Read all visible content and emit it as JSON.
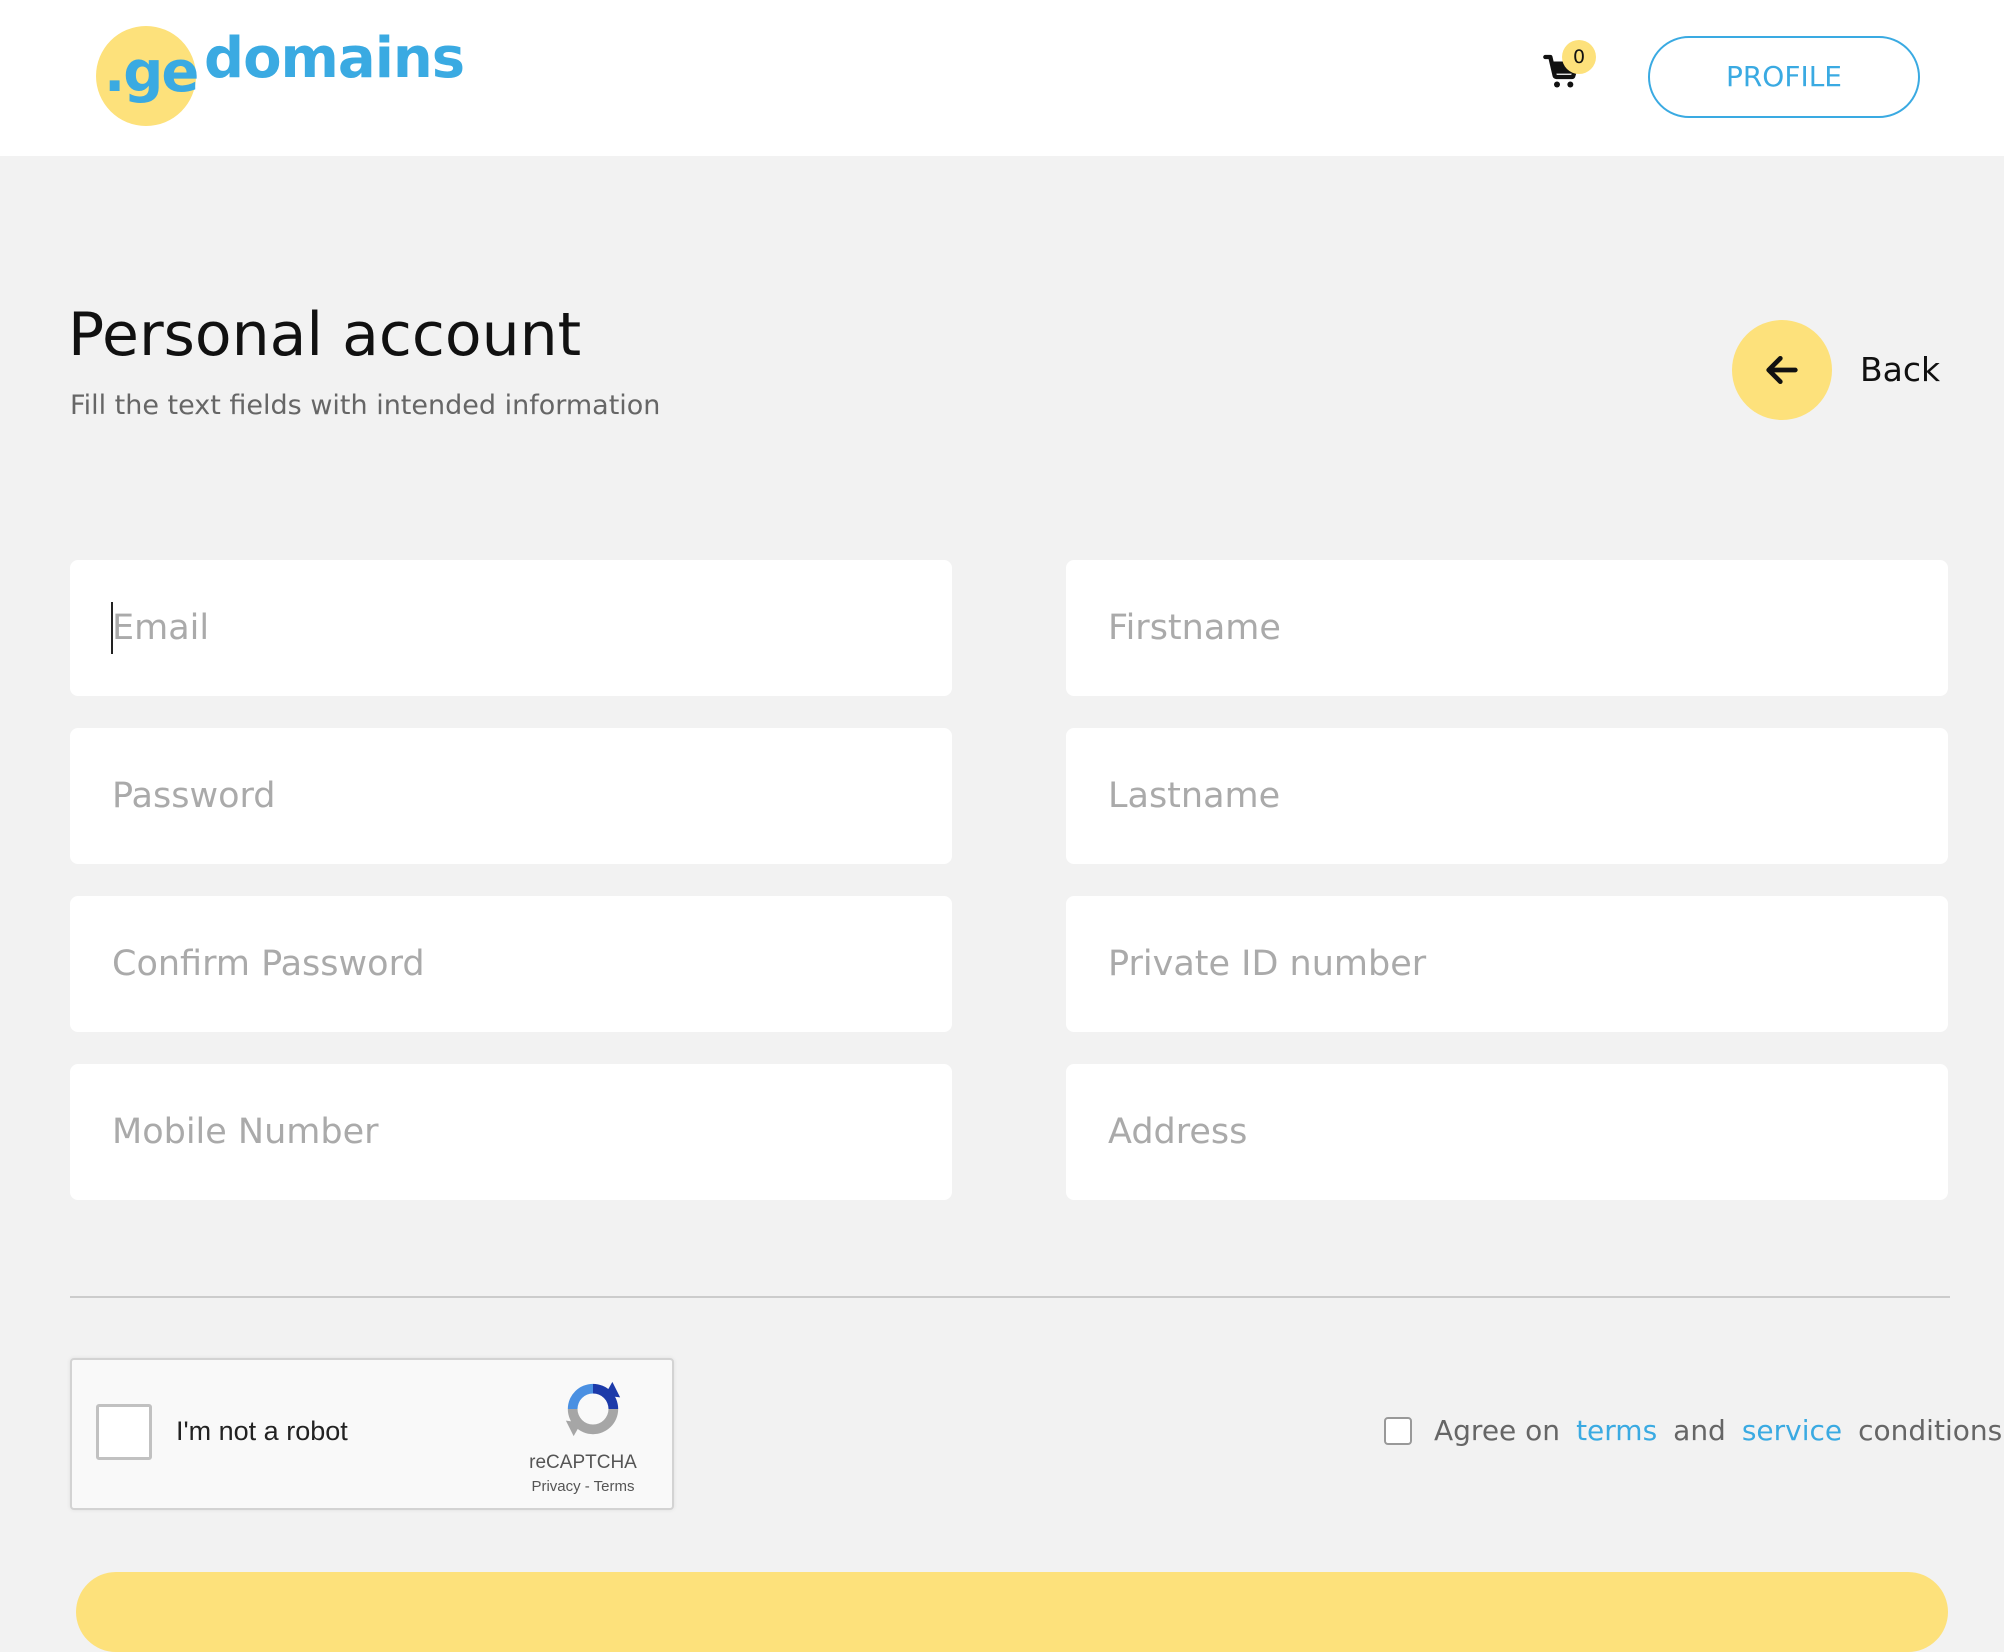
{
  "header": {
    "logo_prefix": ".ge",
    "logo_word": "domains",
    "cart_count": "0",
    "profile_label": "PROFILE"
  },
  "page": {
    "title": "Personal account",
    "subtitle": "Fill the text fields with intended information",
    "back_label": "Back"
  },
  "form": {
    "email_placeholder": "Email",
    "password_placeholder": "Password",
    "confirm_password_placeholder": "Confirm Password",
    "mobile_placeholder": "Mobile Number",
    "firstname_placeholder": "Firstname",
    "lastname_placeholder": "Lastname",
    "private_id_placeholder": "Private ID number",
    "address_placeholder": "Address"
  },
  "recaptcha": {
    "label": "I'm not a robot",
    "brand": "reCAPTCHA",
    "links": "Privacy - Terms"
  },
  "agree": {
    "prefix": "Agree on",
    "terms_link": "terms",
    "and": "and",
    "service_link": "service",
    "suffix": "conditions"
  },
  "icons": {
    "cart": "cart-icon",
    "back": "arrow-left-icon",
    "recaptcha": "recaptcha-logo-icon"
  },
  "colors": {
    "accent_blue": "#3aaae2",
    "accent_yellow": "#fde17b",
    "background": "#f2f2f2"
  }
}
